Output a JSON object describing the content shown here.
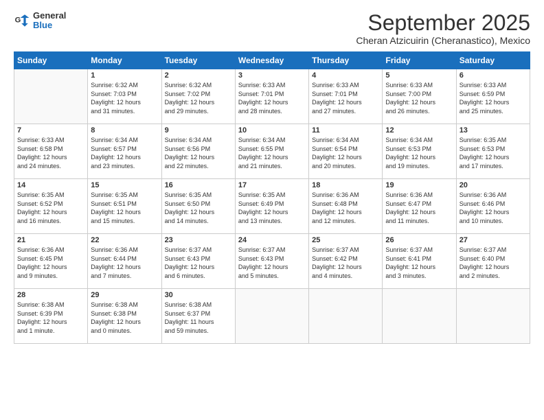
{
  "logo": {
    "line1": "General",
    "line2": "Blue"
  },
  "title": "September 2025",
  "subtitle": "Cheran Atzicuirin (Cheranastico), Mexico",
  "days_header": [
    "Sunday",
    "Monday",
    "Tuesday",
    "Wednesday",
    "Thursday",
    "Friday",
    "Saturday"
  ],
  "weeks": [
    [
      {
        "day": "",
        "text": ""
      },
      {
        "day": "1",
        "text": "Sunrise: 6:32 AM\nSunset: 7:03 PM\nDaylight: 12 hours\nand 31 minutes."
      },
      {
        "day": "2",
        "text": "Sunrise: 6:32 AM\nSunset: 7:02 PM\nDaylight: 12 hours\nand 29 minutes."
      },
      {
        "day": "3",
        "text": "Sunrise: 6:33 AM\nSunset: 7:01 PM\nDaylight: 12 hours\nand 28 minutes."
      },
      {
        "day": "4",
        "text": "Sunrise: 6:33 AM\nSunset: 7:01 PM\nDaylight: 12 hours\nand 27 minutes."
      },
      {
        "day": "5",
        "text": "Sunrise: 6:33 AM\nSunset: 7:00 PM\nDaylight: 12 hours\nand 26 minutes."
      },
      {
        "day": "6",
        "text": "Sunrise: 6:33 AM\nSunset: 6:59 PM\nDaylight: 12 hours\nand 25 minutes."
      }
    ],
    [
      {
        "day": "7",
        "text": "Sunrise: 6:33 AM\nSunset: 6:58 PM\nDaylight: 12 hours\nand 24 minutes."
      },
      {
        "day": "8",
        "text": "Sunrise: 6:34 AM\nSunset: 6:57 PM\nDaylight: 12 hours\nand 23 minutes."
      },
      {
        "day": "9",
        "text": "Sunrise: 6:34 AM\nSunset: 6:56 PM\nDaylight: 12 hours\nand 22 minutes."
      },
      {
        "day": "10",
        "text": "Sunrise: 6:34 AM\nSunset: 6:55 PM\nDaylight: 12 hours\nand 21 minutes."
      },
      {
        "day": "11",
        "text": "Sunrise: 6:34 AM\nSunset: 6:54 PM\nDaylight: 12 hours\nand 20 minutes."
      },
      {
        "day": "12",
        "text": "Sunrise: 6:34 AM\nSunset: 6:53 PM\nDaylight: 12 hours\nand 19 minutes."
      },
      {
        "day": "13",
        "text": "Sunrise: 6:35 AM\nSunset: 6:53 PM\nDaylight: 12 hours\nand 17 minutes."
      }
    ],
    [
      {
        "day": "14",
        "text": "Sunrise: 6:35 AM\nSunset: 6:52 PM\nDaylight: 12 hours\nand 16 minutes."
      },
      {
        "day": "15",
        "text": "Sunrise: 6:35 AM\nSunset: 6:51 PM\nDaylight: 12 hours\nand 15 minutes."
      },
      {
        "day": "16",
        "text": "Sunrise: 6:35 AM\nSunset: 6:50 PM\nDaylight: 12 hours\nand 14 minutes."
      },
      {
        "day": "17",
        "text": "Sunrise: 6:35 AM\nSunset: 6:49 PM\nDaylight: 12 hours\nand 13 minutes."
      },
      {
        "day": "18",
        "text": "Sunrise: 6:36 AM\nSunset: 6:48 PM\nDaylight: 12 hours\nand 12 minutes."
      },
      {
        "day": "19",
        "text": "Sunrise: 6:36 AM\nSunset: 6:47 PM\nDaylight: 12 hours\nand 11 minutes."
      },
      {
        "day": "20",
        "text": "Sunrise: 6:36 AM\nSunset: 6:46 PM\nDaylight: 12 hours\nand 10 minutes."
      }
    ],
    [
      {
        "day": "21",
        "text": "Sunrise: 6:36 AM\nSunset: 6:45 PM\nDaylight: 12 hours\nand 9 minutes."
      },
      {
        "day": "22",
        "text": "Sunrise: 6:36 AM\nSunset: 6:44 PM\nDaylight: 12 hours\nand 7 minutes."
      },
      {
        "day": "23",
        "text": "Sunrise: 6:37 AM\nSunset: 6:43 PM\nDaylight: 12 hours\nand 6 minutes."
      },
      {
        "day": "24",
        "text": "Sunrise: 6:37 AM\nSunset: 6:43 PM\nDaylight: 12 hours\nand 5 minutes."
      },
      {
        "day": "25",
        "text": "Sunrise: 6:37 AM\nSunset: 6:42 PM\nDaylight: 12 hours\nand 4 minutes."
      },
      {
        "day": "26",
        "text": "Sunrise: 6:37 AM\nSunset: 6:41 PM\nDaylight: 12 hours\nand 3 minutes."
      },
      {
        "day": "27",
        "text": "Sunrise: 6:37 AM\nSunset: 6:40 PM\nDaylight: 12 hours\nand 2 minutes."
      }
    ],
    [
      {
        "day": "28",
        "text": "Sunrise: 6:38 AM\nSunset: 6:39 PM\nDaylight: 12 hours\nand 1 minute."
      },
      {
        "day": "29",
        "text": "Sunrise: 6:38 AM\nSunset: 6:38 PM\nDaylight: 12 hours\nand 0 minutes."
      },
      {
        "day": "30",
        "text": "Sunrise: 6:38 AM\nSunset: 6:37 PM\nDaylight: 11 hours\nand 59 minutes."
      },
      {
        "day": "",
        "text": ""
      },
      {
        "day": "",
        "text": ""
      },
      {
        "day": "",
        "text": ""
      },
      {
        "day": "",
        "text": ""
      }
    ]
  ]
}
